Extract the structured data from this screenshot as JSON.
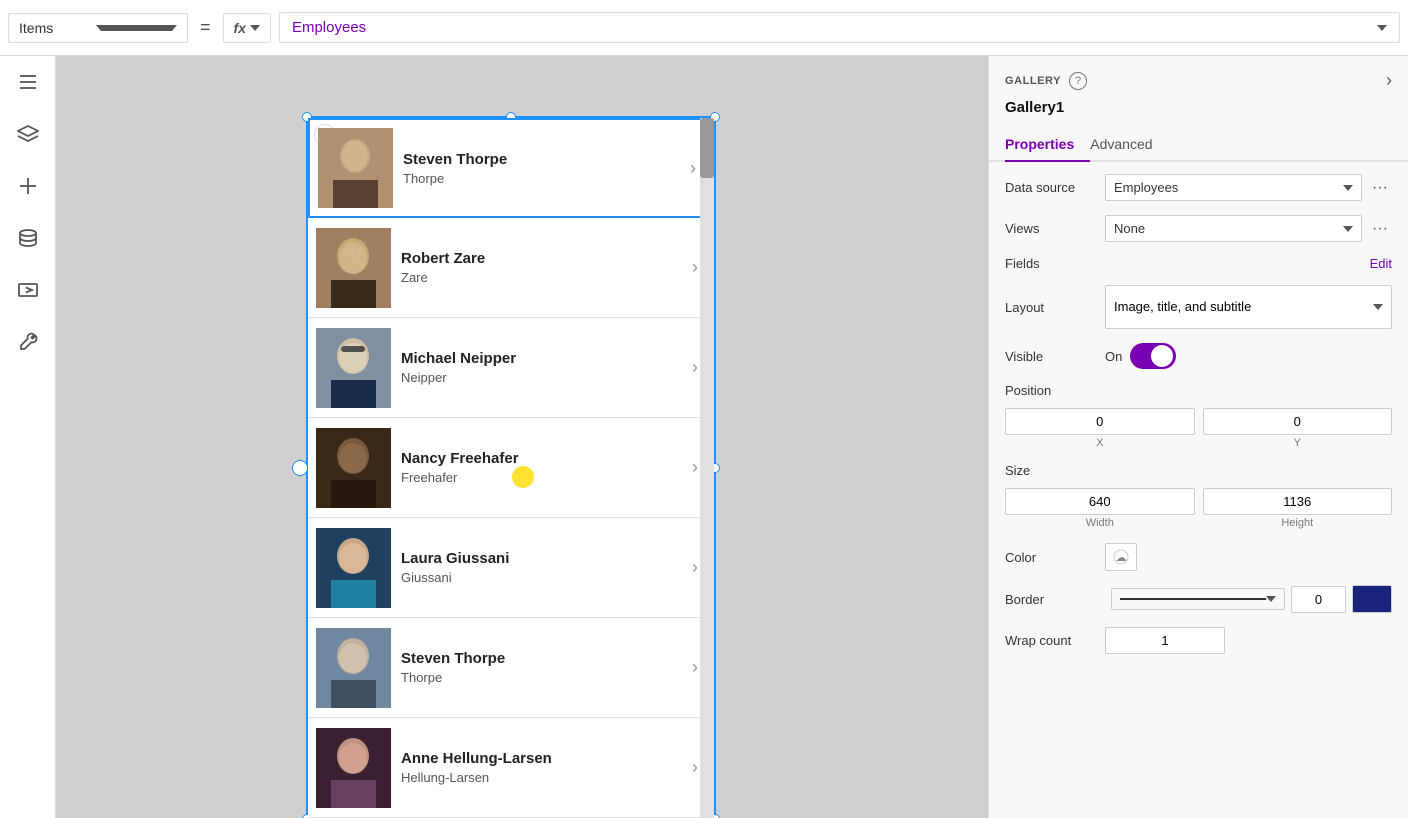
{
  "topbar": {
    "items_label": "Items",
    "equals": "=",
    "fx_label": "fx",
    "formula": "Employees",
    "chevron": "▾"
  },
  "sidebar": {
    "icons": [
      "menu",
      "layers",
      "add",
      "database",
      "media",
      "tools"
    ]
  },
  "gallery": {
    "name": "Gallery1",
    "items": [
      {
        "name": "Steven Thorpe",
        "subtitle": "Thorpe",
        "photo_class": "photo-steven1"
      },
      {
        "name": "Robert Zare",
        "subtitle": "Zare",
        "photo_class": "photo-robert"
      },
      {
        "name": "Michael Neipper",
        "subtitle": "Neipper",
        "photo_class": "photo-michael"
      },
      {
        "name": "Nancy Freehafer",
        "subtitle": "Freehafer",
        "photo_class": "photo-nancy"
      },
      {
        "name": "Laura Giussani",
        "subtitle": "Giussani",
        "photo_class": "photo-laura"
      },
      {
        "name": "Steven Thorpe",
        "subtitle": "Thorpe",
        "photo_class": "photo-steven2"
      },
      {
        "name": "Anne Hellung-Larsen",
        "subtitle": "Hellung-Larsen",
        "photo_class": "photo-anne"
      }
    ]
  },
  "panel": {
    "section_title": "GALLERY",
    "gallery_name": "Gallery1",
    "help_text": "?",
    "tabs": [
      {
        "label": "Properties",
        "active": true
      },
      {
        "label": "Advanced",
        "active": false
      }
    ],
    "properties": {
      "data_source_label": "Data source",
      "data_source_value": "Employees",
      "views_label": "Views",
      "views_value": "None",
      "fields_label": "Fields",
      "fields_edit": "Edit",
      "layout_label": "Layout",
      "layout_value": "Image, title, and subtitle",
      "visible_label": "Visible",
      "visible_on": "On",
      "position_label": "Position",
      "pos_x": "0",
      "pos_y": "0",
      "pos_x_label": "X",
      "pos_y_label": "Y",
      "size_label": "Size",
      "size_width": "640",
      "size_height": "1136",
      "size_w_label": "Width",
      "size_h_label": "Height",
      "color_label": "Color",
      "border_label": "Border",
      "border_zero": "0",
      "wrap_count_label": "Wrap count",
      "wrap_count_value": "1"
    }
  }
}
